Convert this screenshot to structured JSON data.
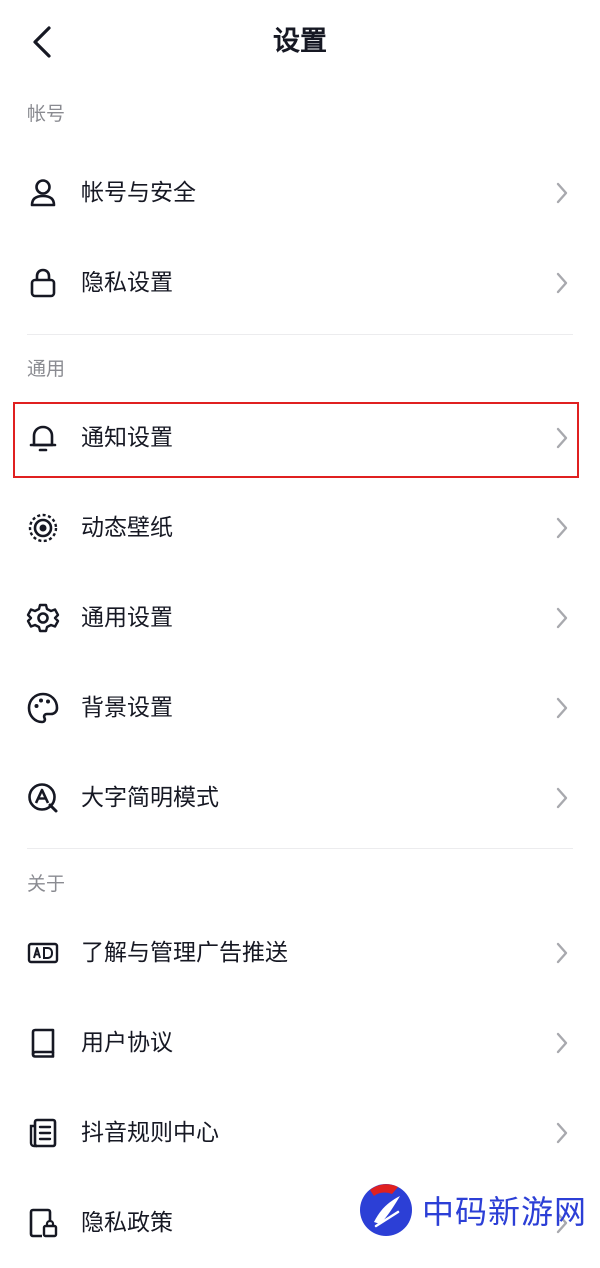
{
  "header": {
    "title": "设置"
  },
  "sections": [
    {
      "label": "帐号",
      "items": [
        {
          "label": "帐号与安全",
          "icon": "user-icon"
        },
        {
          "label": "隐私设置",
          "icon": "lock-icon"
        }
      ]
    },
    {
      "label": "通用",
      "items": [
        {
          "label": "通知设置",
          "icon": "bell-icon"
        },
        {
          "label": "动态壁纸",
          "icon": "wallpaper-icon"
        },
        {
          "label": "通用设置",
          "icon": "gear-icon"
        },
        {
          "label": "背景设置",
          "icon": "palette-icon"
        },
        {
          "label": "大字简明模式",
          "icon": "font-size-icon"
        }
      ]
    },
    {
      "label": "关于",
      "items": [
        {
          "label": "了解与管理广告推送",
          "icon": "ad-icon"
        },
        {
          "label": "用户协议",
          "icon": "book-icon"
        },
        {
          "label": "抖音规则中心",
          "icon": "rules-icon"
        },
        {
          "label": "隐私政策",
          "icon": "privacy-doc-icon"
        }
      ]
    }
  ],
  "highlight": {
    "color": "#e02020"
  },
  "watermark": {
    "text": "中码新游网"
  },
  "colors": {
    "text": "#161823",
    "section_label": "#8a8b91",
    "chevron": "#a8a9ae",
    "divider": "#ececee"
  }
}
